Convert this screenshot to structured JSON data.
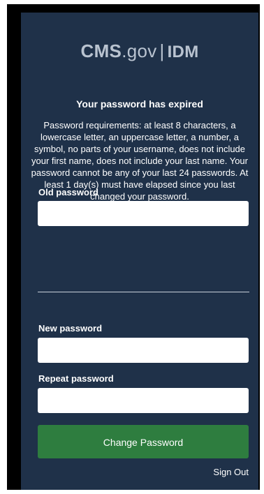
{
  "logo": {
    "brand": "CMS",
    "gov": ".gov",
    "separator": "|",
    "product": "IDM"
  },
  "title": "Your password has expired",
  "requirements": "Password requirements: at least 8 characters, a lowercase letter, an uppercase letter, a number, a symbol, no parts of your username, does not include your first name, does not include your last name. Your password cannot be any of your last 24 passwords. At least 1 day(s) must have elapsed since you last changed your password.",
  "fields": {
    "old_password": {
      "label": "Old password",
      "value": ""
    },
    "new_password": {
      "label": "New password",
      "value": ""
    },
    "repeat_password": {
      "label": "Repeat password",
      "value": ""
    }
  },
  "submit_label": "Change Password",
  "sign_out_label": "Sign Out",
  "colors": {
    "panel_background": "#1f3149",
    "button_green": "#2e7d3f",
    "logo_gray": "#b9c3d0"
  }
}
